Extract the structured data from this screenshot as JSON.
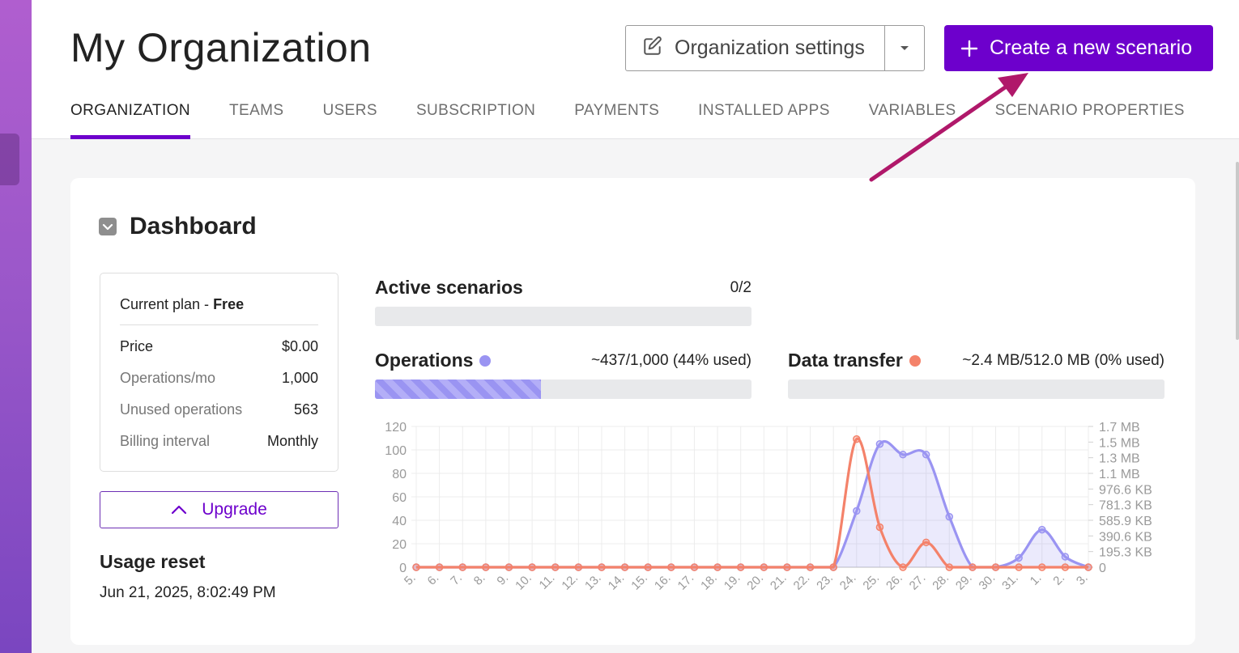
{
  "header": {
    "title": "My Organization",
    "org_settings_label": "Organization settings",
    "create_label": "Create a new scenario",
    "tabs": [
      {
        "label": "ORGANIZATION",
        "active": true
      },
      {
        "label": "TEAMS"
      },
      {
        "label": "USERS"
      },
      {
        "label": "SUBSCRIPTION"
      },
      {
        "label": "PAYMENTS"
      },
      {
        "label": "INSTALLED APPS"
      },
      {
        "label": "VARIABLES"
      },
      {
        "label": "SCENARIO PROPERTIES"
      }
    ]
  },
  "dashboard": {
    "title": "Dashboard",
    "plan": {
      "prefix": "Current plan - ",
      "name": "Free",
      "rows": [
        {
          "key": "Price",
          "value": "$0.00"
        },
        {
          "key": "Operations/mo",
          "value": "1,000"
        },
        {
          "key": "Unused operations",
          "value": "563"
        },
        {
          "key": "Billing interval",
          "value": "Monthly"
        }
      ]
    },
    "upgrade_label": "Upgrade",
    "usage_reset_title": "Usage reset",
    "usage_reset_date": "Jun 21, 2025, 8:02:49 PM",
    "active_scenarios": {
      "title": "Active scenarios",
      "value": "0/2",
      "fraction": 0.0
    },
    "operations": {
      "title": "Operations",
      "value": "~437/1,000 (44% used)",
      "fraction": 0.44
    },
    "data_transfer": {
      "title": "Data transfer",
      "value": "~2.4 MB/512.0 MB (0% used)",
      "fraction": 0.0
    }
  },
  "colors": {
    "accent": "#6d00cc",
    "operations": "#9a94f2",
    "data_transfer": "#f4826a",
    "annotation_arrow": "#b0186a"
  },
  "chart_data": {
    "type": "line",
    "x": [
      "5.",
      "6.",
      "7.",
      "8.",
      "9.",
      "10.",
      "11.",
      "12.",
      "13.",
      "14.",
      "15.",
      "16.",
      "17.",
      "18.",
      "19.",
      "20.",
      "21.",
      "22.",
      "23.",
      "24.",
      "25.",
      "26.",
      "27.",
      "28.",
      "29.",
      "30.",
      "31.",
      "1.",
      "2.",
      "3."
    ],
    "y_left_ticks": [
      "0",
      "20",
      "40",
      "60",
      "80",
      "100",
      "120"
    ],
    "y_left_range": [
      0,
      120
    ],
    "y_right_ticks": [
      "0",
      "195.3 KB",
      "390.6 KB",
      "585.9 KB",
      "781.3 KB",
      "976.6 KB",
      "1.1 MB",
      "1.3 MB",
      "1.5 MB",
      "1.7 MB"
    ],
    "y_right_range_kb": [
      0,
      1757.8
    ],
    "series": [
      {
        "axis": "left",
        "color": "#9a94f2",
        "fill": true,
        "values": [
          0,
          0,
          0,
          0,
          0,
          0,
          0,
          0,
          0,
          0,
          0,
          0,
          0,
          0,
          0,
          0,
          0,
          0,
          0,
          48,
          105,
          96,
          96,
          43,
          0,
          0,
          8,
          32,
          9,
          0
        ]
      },
      {
        "axis": "right",
        "color": "#f4826a",
        "fill": false,
        "values": [
          0,
          0,
          0,
          0,
          0,
          0,
          0,
          0,
          0,
          0,
          0,
          0,
          0,
          0,
          0,
          0,
          0,
          0,
          0,
          1600,
          500,
          0,
          310,
          0,
          0,
          0,
          0,
          0,
          0,
          0
        ]
      }
    ],
    "grid": true
  }
}
